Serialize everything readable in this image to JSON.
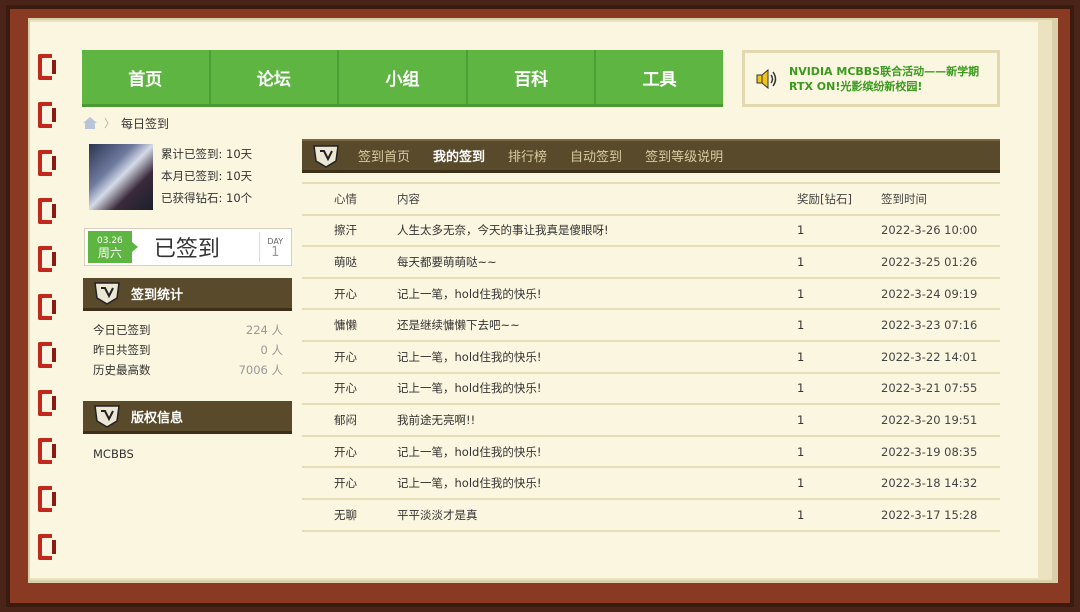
{
  "nav": {
    "items": [
      "首页",
      "论坛",
      "小组",
      "百科",
      "工具"
    ]
  },
  "announcement": {
    "icon": "speaker-icon",
    "text": "NVIDIA MCBBS联合活动——新学期 RTX ON!光影缤纷新校园!"
  },
  "breadcrumb": {
    "icon": "home-icon",
    "current": "每日签到"
  },
  "profile": {
    "total_signed": "累计已签到: 10天",
    "month_signed": "本月已签到: 10天",
    "diamonds": "已获得钻石: 10个"
  },
  "sign_box": {
    "date": "03.26",
    "weekday": "周六",
    "status": "已签到",
    "day_label": "DAY",
    "day_num": "1"
  },
  "stats": {
    "title": "签到统计",
    "rows": [
      {
        "label": "今日已签到",
        "value": "224 人"
      },
      {
        "label": "昨日共签到",
        "value": "0 人"
      },
      {
        "label": "历史最高数",
        "value": "7006 人"
      }
    ]
  },
  "copyright": {
    "title": "版权信息",
    "text": "MCBBS"
  },
  "tabs": [
    {
      "label": "签到首页",
      "active": false
    },
    {
      "label": "我的签到",
      "active": true
    },
    {
      "label": "排行榜",
      "active": false
    },
    {
      "label": "自动签到",
      "active": false
    },
    {
      "label": "签到等级说明",
      "active": false
    }
  ],
  "table": {
    "headers": [
      "心情",
      "内容",
      "奖励[钻石]",
      "签到时间"
    ],
    "rows": [
      [
        "擦汗",
        "人生太多无奈，今天的事让我真是傻眼呀!",
        "1",
        "2022-3-26 10:00"
      ],
      [
        "萌哒",
        "每天都要萌萌哒~~",
        "1",
        "2022-3-25 01:26"
      ],
      [
        "开心",
        "记上一笔，hold住我的快乐!",
        "1",
        "2022-3-24 09:19"
      ],
      [
        "慵懒",
        "还是继续慵懒下去吧~~",
        "1",
        "2022-3-23 07:16"
      ],
      [
        "开心",
        "记上一笔，hold住我的快乐!",
        "1",
        "2022-3-22 14:01"
      ],
      [
        "开心",
        "记上一笔，hold住我的快乐!",
        "1",
        "2022-3-21 07:55"
      ],
      [
        "郁闷",
        "我前途无亮啊!!",
        "1",
        "2022-3-20 19:51"
      ],
      [
        "开心",
        "记上一笔，hold住我的快乐!",
        "1",
        "2022-3-19 08:35"
      ],
      [
        "开心",
        "记上一笔，hold住我的快乐!",
        "1",
        "2022-3-18 14:32"
      ],
      [
        "无聊",
        "平平淡淡才是真",
        "1",
        "2022-3-17 15:28"
      ]
    ]
  },
  "colors": {
    "nav_green": "#5fb542",
    "header_brown": "#5a4a2c",
    "page_bg": "#fbf6df",
    "binding_red": "#c4281d"
  }
}
